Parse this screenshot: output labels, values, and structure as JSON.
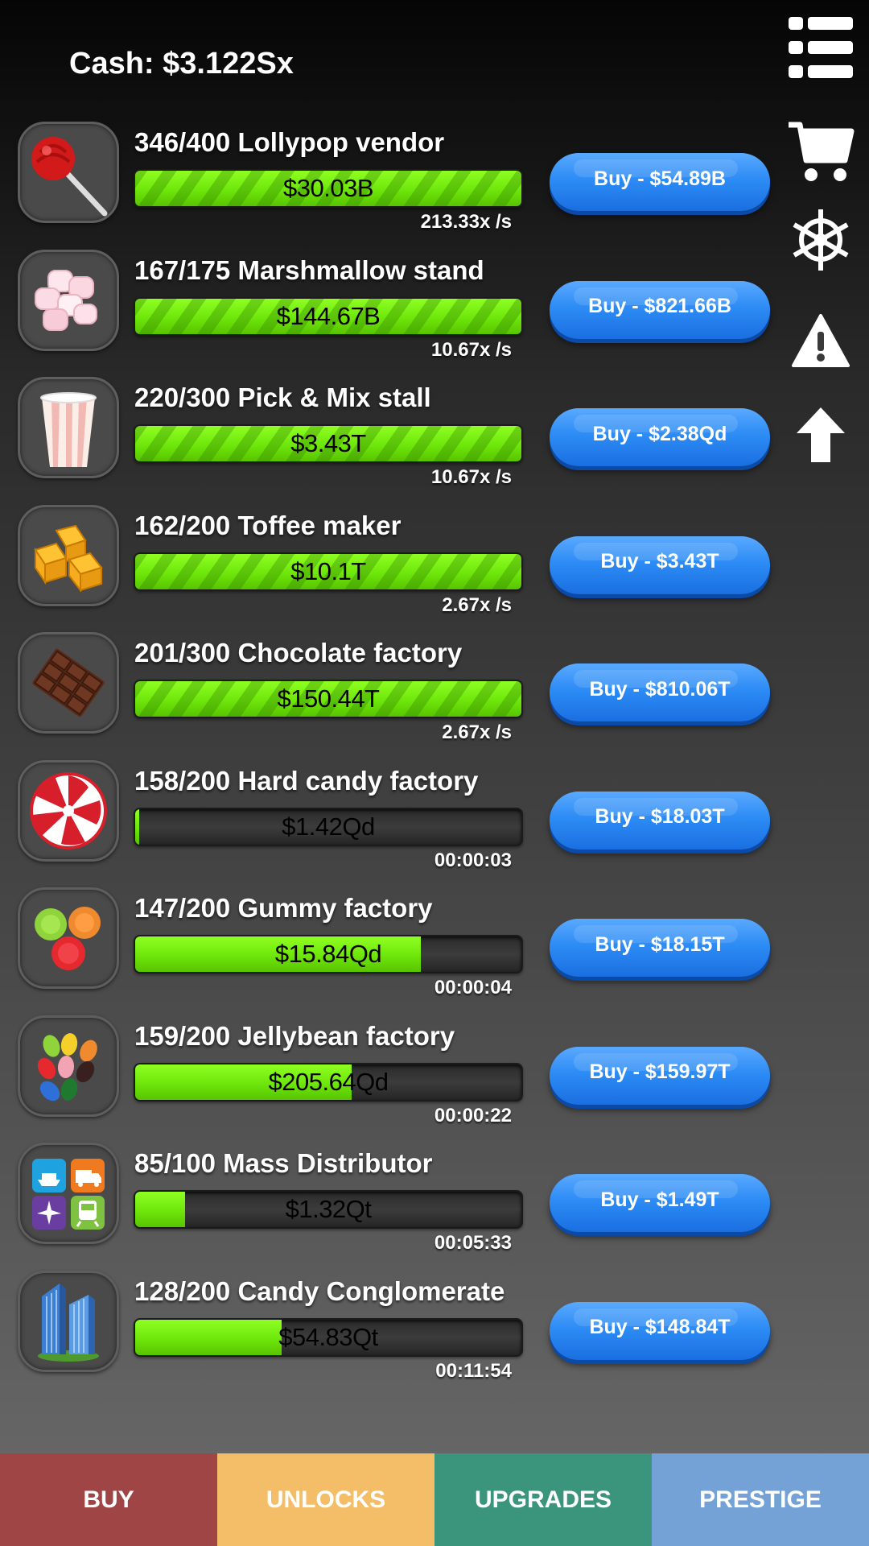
{
  "header": {
    "cash": "Cash: $3.122Sx"
  },
  "side_menu": [
    {
      "icon": "menu-list-icon"
    },
    {
      "icon": "shopping-cart-icon"
    },
    {
      "icon": "ship-wheel-icon"
    },
    {
      "icon": "warning-icon"
    },
    {
      "icon": "arrow-up-icon"
    }
  ],
  "businesses": [
    {
      "title": "346/400 Lollypop vendor",
      "amount": "$30.03B",
      "rate": "213.33x /s",
      "buy": "Buy - $54.89B",
      "progress": 1.0,
      "striped": true,
      "icon": "lollipop-icon"
    },
    {
      "title": "167/175 Marshmallow stand",
      "amount": "$144.67B",
      "rate": "10.67x /s",
      "buy": "Buy - $821.66B",
      "progress": 1.0,
      "striped": true,
      "icon": "marshmallow-icon"
    },
    {
      "title": "220/300 Pick & Mix stall",
      "amount": "$3.43T",
      "rate": "10.67x /s",
      "buy": "Buy - $2.38Qd",
      "progress": 1.0,
      "striped": true,
      "icon": "popcorn-cup-icon"
    },
    {
      "title": "162/200 Toffee maker",
      "amount": "$10.1T",
      "rate": "2.67x /s",
      "buy": "Buy - $3.43T",
      "progress": 1.0,
      "striped": true,
      "icon": "toffee-icon"
    },
    {
      "title": "201/300 Chocolate factory",
      "amount": "$150.44T",
      "rate": "2.67x /s",
      "buy": "Buy - $810.06T",
      "progress": 1.0,
      "striped": true,
      "icon": "chocolate-bar-icon"
    },
    {
      "title": "158/200 Hard candy factory",
      "amount": "$1.42Qd",
      "rate": "00:00:03",
      "buy": "Buy - $18.03T",
      "progress": 0.01,
      "striped": false,
      "icon": "peppermint-candy-icon"
    },
    {
      "title": "147/200 Gummy factory",
      "amount": "$15.84Qd",
      "rate": "00:00:04",
      "buy": "Buy - $18.15T",
      "progress": 0.74,
      "striped": false,
      "icon": "gummy-icon"
    },
    {
      "title": "159/200 Jellybean factory",
      "amount": "$205.64Qd",
      "rate": "00:00:22",
      "buy": "Buy - $159.97T",
      "progress": 0.56,
      "striped": false,
      "icon": "jellybean-icon"
    },
    {
      "title": "85/100 Mass Distributor",
      "amount": "$1.32Qt",
      "rate": "00:05:33",
      "buy": "Buy - $1.49T",
      "progress": 0.13,
      "striped": false,
      "icon": "distribution-transport-icon"
    },
    {
      "title": "128/200 Candy Conglomerate",
      "amount": "$54.83Qt",
      "rate": "00:11:54",
      "buy": "Buy - $148.84T",
      "progress": 0.38,
      "striped": false,
      "icon": "skyscraper-icon"
    }
  ],
  "tabs": [
    {
      "label": "BUY",
      "color": "#a04545"
    },
    {
      "label": "UNLOCKS",
      "color": "#f4be68"
    },
    {
      "label": "UPGRADES",
      "color": "#3b957c"
    },
    {
      "label": "PRESTIGE",
      "color": "#74a2d6"
    }
  ]
}
